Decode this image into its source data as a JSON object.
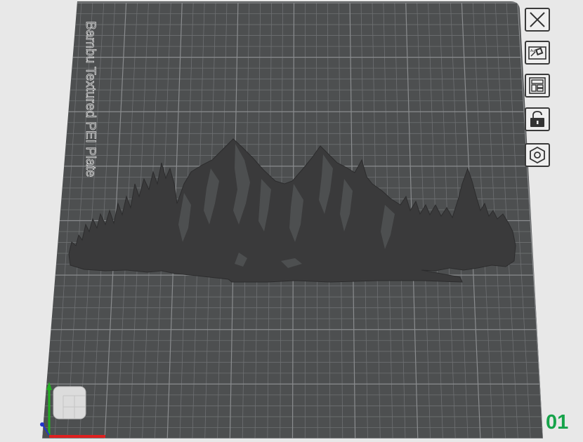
{
  "plate": {
    "label": "Bambu Textured PEI Plate",
    "number": "01"
  },
  "toolbar": [
    {
      "name": "close-plate-button",
      "icon": "close-icon"
    },
    {
      "name": "auto-orient-button",
      "icon": "auto-orient-icon"
    },
    {
      "name": "arrange-button",
      "icon": "arrange-icon"
    },
    {
      "name": "lock-plate-button",
      "icon": "lock-icon"
    },
    {
      "name": "plate-settings-button",
      "icon": "plate-settings-icon"
    }
  ],
  "colors": {
    "background": "#e8e8e8",
    "plate": "#4d4f50",
    "grid_minor": "#6e7072",
    "grid_major": "#8a8c8e",
    "model": "#3a3a3b",
    "plate_number": "#16a34a",
    "axis_x": "#e02020",
    "axis_y": "#22b022",
    "axis_z": "#2233cc"
  }
}
